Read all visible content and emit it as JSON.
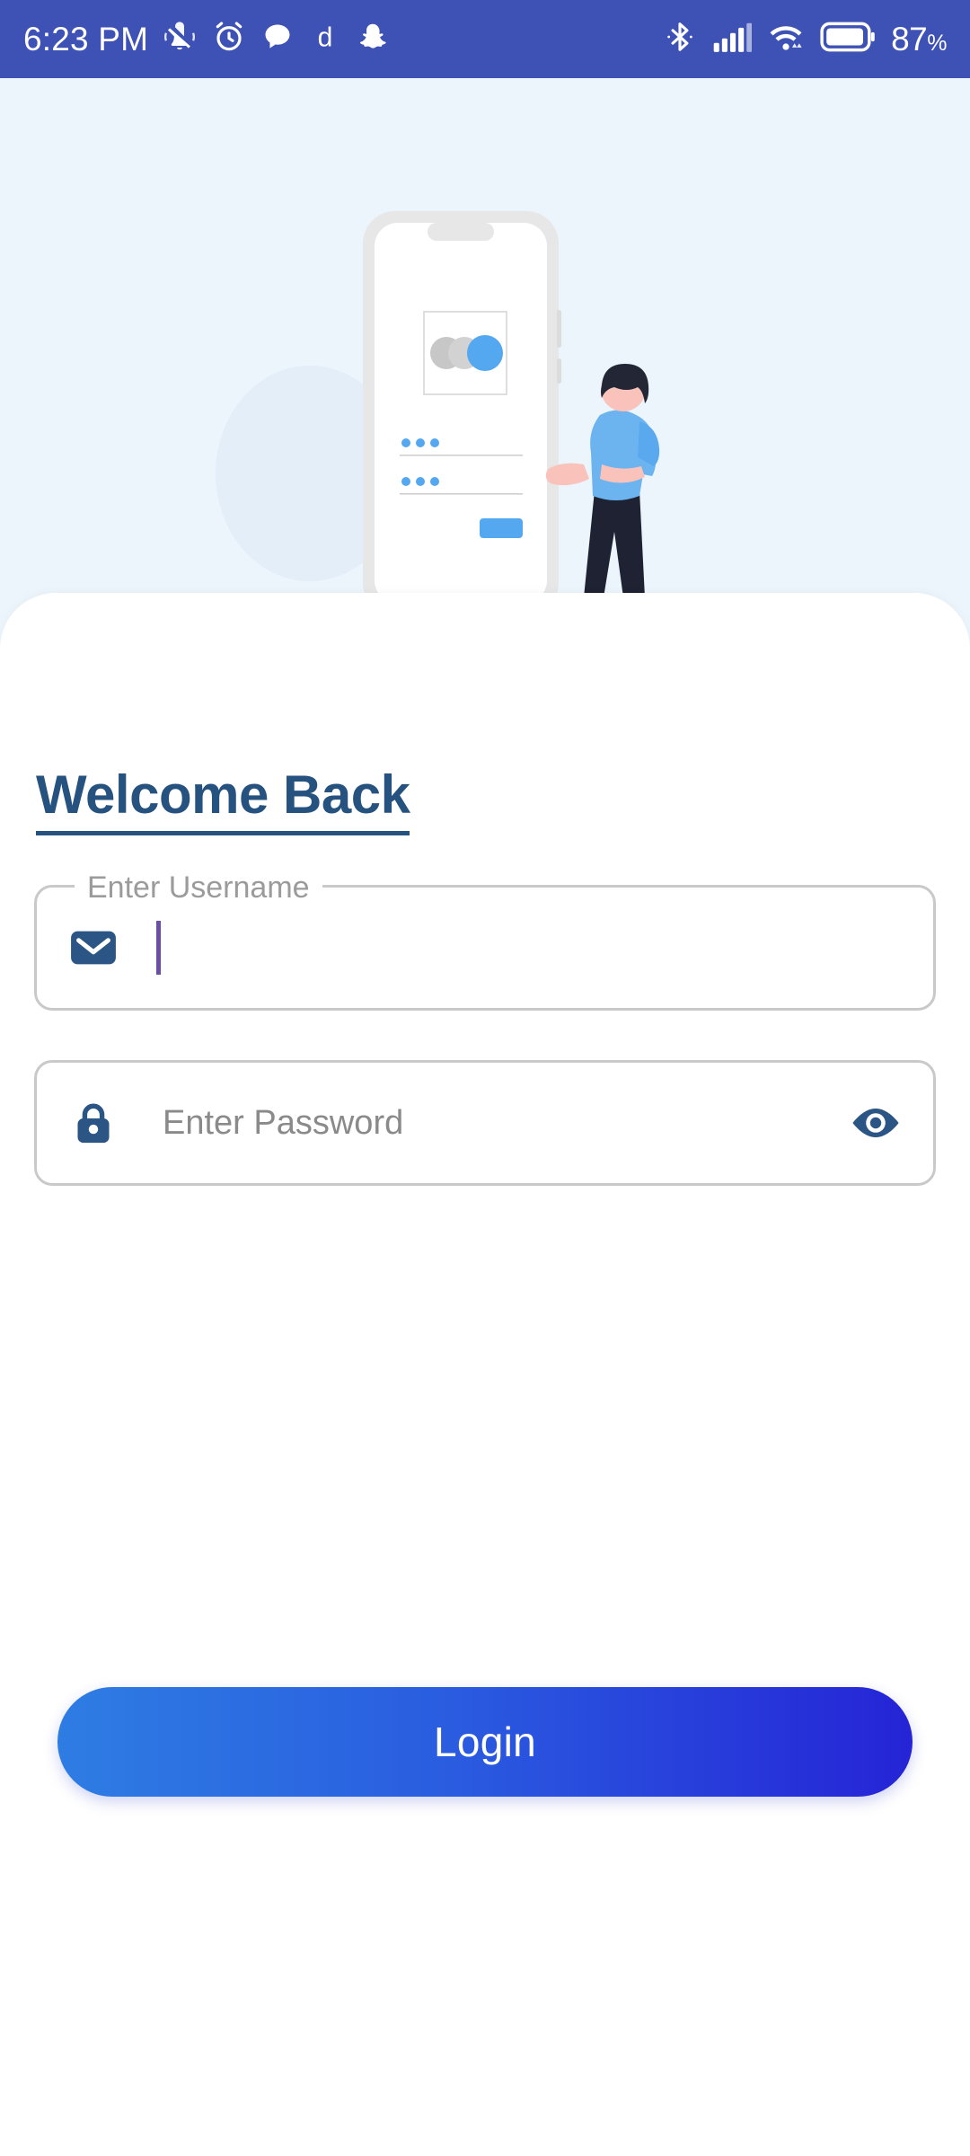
{
  "status_bar": {
    "time": "6:23 PM",
    "background_color": "#3e51b5",
    "left_icons": [
      {
        "name": "vibrate-off-icon",
        "label": "Silent / vibrate off"
      },
      {
        "name": "alarm-clock-icon",
        "label": "Alarm set"
      },
      {
        "name": "chat-bubble-icon",
        "label": "Messaging notification"
      },
      {
        "name": "dailyhunt-icon",
        "label": "d"
      },
      {
        "name": "snapchat-ghost-icon",
        "label": "Snapchat notification"
      }
    ],
    "right_icons": [
      {
        "name": "bluetooth-icon",
        "label": "Bluetooth on"
      },
      {
        "name": "cellular-signal-icon",
        "label": "Signal strength"
      },
      {
        "name": "wifi-icon",
        "label": "Wi-Fi connected"
      },
      {
        "name": "battery-icon",
        "label": "Battery"
      }
    ],
    "battery_percent": "87",
    "battery_percent_sign": "%"
  },
  "hero": {
    "background_color": "#ecf4fc",
    "illustration_name": "login-phone-person-illustration",
    "phone_body_color": "#e6e6e6",
    "accent_blue": "#54a8ef",
    "person": {
      "shirt_color": "#6cb4f0",
      "pants_color": "#1f2233",
      "skin_color": "#f9c3bb",
      "hair_color": "#232634"
    }
  },
  "card": {
    "background_color": "#ffffff",
    "title": "Welcome Back",
    "title_color": "#26527f"
  },
  "form": {
    "username": {
      "label": "Enter Username",
      "value": "",
      "placeholder": "",
      "icon": "mail-envelope-icon",
      "icon_color": "#2b5584",
      "focused": true,
      "caret_color": "#6b4fa5"
    },
    "password": {
      "label": "",
      "value": "",
      "placeholder": "Enter Password",
      "icon": "lock-icon",
      "icon_color": "#2b5584",
      "toggle_icon": "eye-visibility-icon",
      "focused": false
    }
  },
  "actions": {
    "login_label": "Login",
    "login_gradient_start": "#2e7de3",
    "login_gradient_end": "#2524d6"
  }
}
